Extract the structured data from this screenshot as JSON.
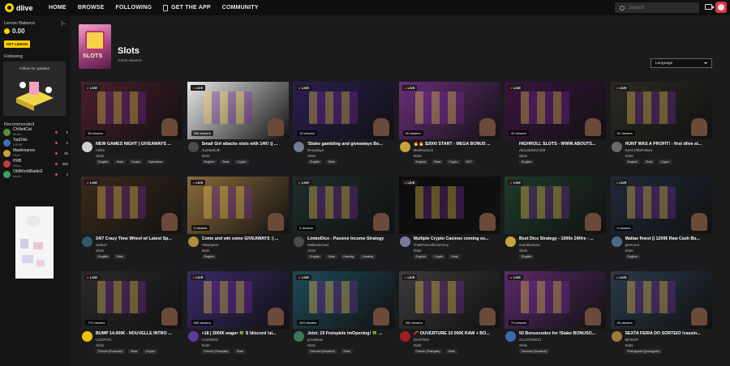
{
  "header": {
    "logo_text": "dlive",
    "nav": [
      "HOME",
      "BROWSE",
      "FOLLOWING",
      "GET THE APP",
      "COMMUNITY"
    ],
    "search_placeholder": "Search"
  },
  "sidebar": {
    "balance_label": "Lemon Balance",
    "balance_value": "0.00",
    "get_lemon": "GET LEMON",
    "following_label": "Following",
    "follow_prompt": "Follow for updates",
    "recommended_label": "Recommended",
    "recommended": [
      {
        "name": "ChilledCat",
        "category": "Music",
        "count": "5",
        "color": "#5a8f3a"
      },
      {
        "name": "TopDisk",
        "category": "ASMR",
        "count": "2",
        "color": "#3a6fb0"
      },
      {
        "name": "Mashmanos",
        "category": "Slots",
        "count": "30",
        "color": "#c9a23b"
      },
      {
        "name": "PRB",
        "category": "News",
        "count": "365",
        "color": "#c33a3a"
      },
      {
        "name": "OldWorldRadio2",
        "category": "Music",
        "count": "4",
        "color": "#3aa060"
      }
    ]
  },
  "category": {
    "title": "Slots",
    "cover_word": "SLOTS",
    "viewers": "3,515 viewers",
    "language_label": "Language"
  },
  "cards": [
    {
      "title": "NEW GAMES NIGHT | GIVEAWAYS ...",
      "streamer": "ru0ke",
      "category": "Slots",
      "viewers": "38 viewers",
      "tags": [
        "English",
        "Slots",
        "Crypto",
        "Spendrise"
      ],
      "thumb": "#4a1e2a",
      "av": "#cfcfcf"
    },
    {
      "title": "Small Girl attacks slots with 14K! || ...",
      "streamer": "Aussiesloth",
      "category": "Slots",
      "viewers": "286 viewers",
      "tags": [
        "English",
        "Slots",
        "Crypto"
      ],
      "thumb": "#e8e8e8",
      "av": "#4a4a4a"
    },
    {
      "title": "!Stake gambling and giveaways Bo...",
      "streamer": "Draxplays",
      "category": "Slots",
      "viewers": "13 viewers",
      "tags": [
        "English",
        "Slots"
      ],
      "thumb": "#2b1d52",
      "av": "#6f7f8f"
    },
    {
      "title": "🔥🔥 $2000 START - MEGA BONUS ...",
      "streamer": "Mashmanos",
      "category": "Slots",
      "viewers": "30 viewers",
      "tags": [
        "English",
        "Slots",
        "Crypto",
        "NFT"
      ],
      "thumb": "#6a2e7a",
      "av": "#c9a23b"
    },
    {
      "title": "HIGHROLL SLOTS - WWW.ABOUTS...",
      "streamer": "AboutSlotsCOM",
      "category": "Slots",
      "viewers": "20 viewers",
      "tags": [
        "English"
      ],
      "thumb": "#3a1440",
      "av": "#1b1b1b"
    },
    {
      "title": "HUNT WAS A PROFIT! - first dlive st...",
      "streamer": "KenCraftsPokies",
      "category": "Slots",
      "viewers": "31 viewers",
      "tags": [
        "English",
        "Slots",
        "Crypto"
      ],
      "thumb": "#2c2a24",
      "av": "#6a6a6a"
    },
    {
      "title": "24/7 Crazy Time Wheel w/ Latest Sp...",
      "streamer": "owl247",
      "category": "Slots",
      "viewers": "",
      "tags": [
        "English",
        "Slots"
      ],
      "thumb": "#3a2a1a",
      "av": "#2e5a6a"
    },
    {
      "title": "Come and win some GIVEAWAYS :) ...",
      "streamer": "Yakaspers",
      "category": "Slots",
      "viewers": "3 viewers",
      "tags": [
        "English"
      ],
      "thumb": "#8a6b3a",
      "av": "#b58a3a"
    },
    {
      "title": "LimboDice - Passive Income Strategy",
      "streamer": "MrBlackCard",
      "category": "Slots",
      "viewers": "2 viewers",
      "tags": [
        "English",
        "Slots",
        "Gaming",
        "Creative"
      ],
      "thumb": "#1e2d2c",
      "av": "#4a4a4a"
    },
    {
      "title": "Multiple Crypto Casinos coming so...",
      "streamer": "ThatPAScrollUserGuy",
      "category": "Slots",
      "viewers": "",
      "tags": [
        "English",
        "Crypto",
        "Slots"
      ],
      "thumb": "#0c0c0c",
      "av": "#7a7aa0"
    },
    {
      "title": "Best Dice Strategy - 1000x 24Hrs - ...",
      "streamer": "GambleZone",
      "category": "Slots",
      "viewers": "",
      "tags": [
        "English"
      ],
      "thumb": "#1e3a2a",
      "av": "#c9a23b"
    },
    {
      "title": "Maltas finest || 1200€ Raw Cash Bo...",
      "streamer": "gemooot",
      "category": "Slots",
      "viewers": "0 viewers",
      "tags": [
        "English"
      ],
      "thumb": "#1e2a3a",
      "av": "#4a6a8a"
    },
    {
      "title": "BUMP 14.000€ - NOUVELLE INTRO ...",
      "streamer": "LOOPOG",
      "category": "Slots",
      "viewers": "770 viewers",
      "tags": [
        "French (Français)",
        "Slots",
        "Crypto"
      ],
      "thumb": "#2a2a2a",
      "av": "#e8c400"
    },
    {
      "title": "+18 | 3000€ wager 🍀 $ !discord !ai...",
      "streamer": "CASINRO",
      "category": "Slots",
      "viewers": "553 viewers",
      "tags": [
        "French (Français)",
        "Slots"
      ],
      "thumb": "#3a2a6a",
      "av": "#5a3a9a"
    },
    {
      "title": "Jetzt: 19 Freispiele imOpening! 🍀 ...",
      "streamer": "gYoWeas",
      "category": "Slots",
      "viewers": "263 viewers",
      "tags": [
        "German (Deutsch)",
        "Slots"
      ],
      "thumb": "#1e4a5a",
      "av": "#3a7a5a"
    },
    {
      "title": "🧨 OUVERTURE 10 000€ RAW + BO...",
      "streamer": "DANTRIX",
      "category": "Slots",
      "viewers": "262 viewers",
      "tags": [
        "French (Français)",
        "Slots"
      ],
      "thumb": "#3a3a3a",
      "av": "#a01e1e"
    },
    {
      "title": "50 Bonuscodes for !Stake BONUSO...",
      "streamer": "ALLSTARZ21",
      "category": "Slots",
      "viewers": "73 viewers",
      "tags": [
        "German (Deutsch)"
      ],
      "thumb": "#5a2a6a",
      "av": "#3a6ab0"
    },
    {
      "title": "SEXTA FEIRA DO SORTEIO !cassin...",
      "streamer": "MHMVP",
      "category": "Slots",
      "viewers": "40 viewers",
      "tags": [
        "Portuguese (português)"
      ],
      "thumb": "#2a3a4a",
      "av": "#a07a3a"
    }
  ]
}
